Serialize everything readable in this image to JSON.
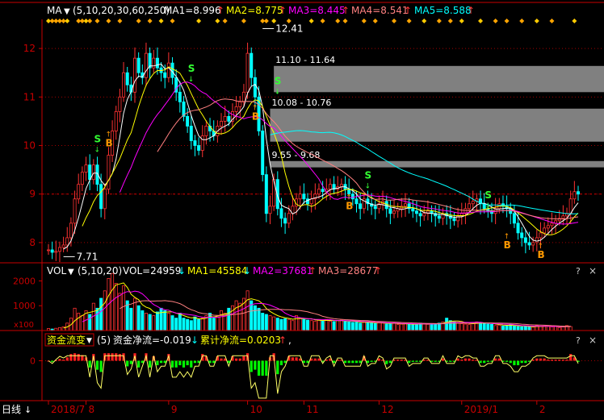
{
  "main_header": {
    "indicator": "MA",
    "params": "(5,10,20,30,60,250)",
    "items": [
      {
        "label": "MA1=8.996",
        "arrow": "↑",
        "color": "#ffffff"
      },
      {
        "label": "MA2=8.775",
        "arrow": "↑",
        "color": "#ffff00"
      },
      {
        "label": "MA3=8.445",
        "arrow": "↑",
        "color": "#ff00ff"
      },
      {
        "label": "MA4=8.541",
        "arrow": "↑",
        "color": "#ff8080"
      },
      {
        "label": "MA5=8.588",
        "arrow": "↑",
        "color": "#00ffff"
      }
    ]
  },
  "vol_header": {
    "indicator": "VOL",
    "params": "(5,10,20)",
    "value": "VOL=24959",
    "items": [
      {
        "label": "MA1=45584",
        "arrow": "↓",
        "color": "#ffff00"
      },
      {
        "label": "MA2=37681",
        "arrow": "↑",
        "color": "#ff00ff"
      },
      {
        "label": "MA3=28677",
        "arrow": "↑",
        "color": "#ff8080"
      }
    ]
  },
  "flow_header": {
    "indicator": "资金流变",
    "params": "(5)",
    "net": "资金净流=-0.019",
    "net_arrow": "↓",
    "cum": "累计净流=0.0203",
    "cum_arrow": "↑",
    "tail": ","
  },
  "toolbar": {
    "question": "?",
    "close": "×",
    "period": "日线"
  },
  "vol_unit": "x100",
  "bottom_arrow": "↓",
  "colors": {
    "up": "#ff3232",
    "down": "#00ffff",
    "zone": "#808080",
    "grid": "#a00000",
    "buy": "#ff9900",
    "sell": "#33ff33"
  },
  "chart_data": {
    "type": "candlestick",
    "ylim": [
      7.65,
      12.6
    ],
    "y_ticks": [
      8,
      9,
      10,
      11,
      12
    ],
    "x_labels": [
      {
        "label": "2018/7",
        "index": 0
      },
      {
        "label": "8",
        "index": 10
      },
      {
        "label": "9",
        "index": 32
      },
      {
        "label": "10",
        "index": 53
      },
      {
        "label": "11",
        "index": 68
      },
      {
        "label": "12",
        "index": 88
      },
      {
        "label": "2019/1",
        "index": 110
      },
      {
        "label": "2",
        "index": 130
      }
    ],
    "closes": [
      7.85,
      7.8,
      7.82,
      7.9,
      7.95,
      8.1,
      8.4,
      8.9,
      9.2,
      9.45,
      9.6,
      9.3,
      9.6,
      9.2,
      8.7,
      9.1,
      9.8,
      10.3,
      10.7,
      11.0,
      11.5,
      11.25,
      11.1,
      11.8,
      11.5,
      11.4,
      11.9,
      11.6,
      11.8,
      11.6,
      11.5,
      11.4,
      11.7,
      11.4,
      11.1,
      10.9,
      10.6,
      10.4,
      10.1,
      10.0,
      9.9,
      10.2,
      10.4,
      10.3,
      10.2,
      10.4,
      10.5,
      10.6,
      10.5,
      10.7,
      10.8,
      10.9,
      11.1,
      11.9,
      11.4,
      11.0,
      10.3,
      9.4,
      8.6,
      8.75,
      9.3,
      8.7,
      8.5,
      8.4,
      8.6,
      8.75,
      8.9,
      9.0,
      8.9,
      8.8,
      8.9,
      9.0,
      9.1,
      9.05,
      9.1,
      9.2,
      9.1,
      9.15,
      9.2,
      9.1,
      9.0,
      8.9,
      8.8,
      8.7,
      8.9,
      8.8,
      8.75,
      8.7,
      8.8,
      8.85,
      8.7,
      8.6,
      8.65,
      8.7,
      8.75,
      8.8,
      8.7,
      8.65,
      8.6,
      8.55,
      8.6,
      8.65,
      8.6,
      8.55,
      8.5,
      8.6,
      8.55,
      8.5,
      8.45,
      8.55,
      8.6,
      8.7,
      8.8,
      8.85,
      8.9,
      8.8,
      8.7,
      8.65,
      8.6,
      8.7,
      8.8,
      8.75,
      8.7,
      8.6,
      8.4,
      8.2,
      8.1,
      8.0,
      7.95,
      8.0,
      8.1,
      8.2,
      8.3,
      8.35,
      8.4,
      8.45,
      8.5,
      8.55,
      8.6,
      8.9,
      9.05,
      9.0
    ],
    "zones": [
      {
        "label": "11.10 - 11.64",
        "low": 11.1,
        "high": 11.64,
        "from_index": 60
      },
      {
        "label": "10.08 - 10.76",
        "low": 10.08,
        "high": 10.76,
        "from_index": 59
      },
      {
        "label": "9.55 - 9.68",
        "low": 9.55,
        "high": 9.68,
        "from_index": 59
      }
    ],
    "annotations": [
      {
        "text": "12.41",
        "index": 57,
        "value": 12.41
      },
      {
        "text": "7.71",
        "index": 4,
        "value": 7.71
      }
    ],
    "signals": [
      {
        "type": "B",
        "index": 16,
        "value": 10.25
      },
      {
        "type": "S",
        "index": 13,
        "value": 10.0
      },
      {
        "type": "S",
        "index": 38,
        "value": 11.45
      },
      {
        "type": "B",
        "index": 55,
        "value": 10.8
      },
      {
        "type": "S",
        "index": 61,
        "value": 11.2
      },
      {
        "type": "B",
        "index": 80,
        "value": 8.95
      },
      {
        "type": "S",
        "index": 85,
        "value": 9.25
      },
      {
        "type": "B",
        "index": 122,
        "value": 8.15
      },
      {
        "type": "S",
        "index": 117,
        "value": 8.85
      },
      {
        "type": "B",
        "index": 131,
        "value": 7.95
      }
    ],
    "vol_ylim": [
      0,
      2600
    ],
    "vol_ticks": [
      1000,
      2000
    ],
    "volumes": [
      80,
      60,
      90,
      120,
      150,
      300,
      500,
      900,
      700,
      600,
      800,
      650,
      1100,
      900,
      1300,
      1600,
      2100,
      2300,
      1900,
      1500,
      1800,
      1200,
      900,
      1300,
      1000,
      800,
      700,
      650,
      600,
      750,
      900,
      800,
      700,
      600,
      500,
      700,
      500,
      450,
      400,
      550,
      450,
      500,
      600,
      700,
      500,
      600,
      800,
      700,
      900,
      1000,
      1200,
      1100,
      1300,
      1600,
      1200,
      1000,
      900,
      700,
      650,
      600,
      550,
      500,
      450,
      480,
      450,
      400,
      600,
      500,
      450,
      420,
      400,
      380,
      420,
      400,
      450,
      380,
      360,
      400,
      420,
      380,
      350,
      330,
      340,
      300,
      360,
      320,
      300,
      280,
      330,
      300,
      260,
      280,
      300,
      240,
      260,
      280,
      250,
      230,
      260,
      300,
      280,
      250,
      260,
      280,
      300,
      350,
      500,
      400,
      350,
      300,
      280,
      260,
      240,
      300,
      350,
      330,
      280,
      260,
      250,
      200,
      220,
      180,
      200,
      250,
      180,
      160,
      150,
      170,
      150,
      140,
      200,
      160,
      180,
      170,
      150,
      160,
      120,
      150,
      200,
      160
    ],
    "flow_ylim": [
      -1.6,
      0.5
    ],
    "flow_ticks": [
      0
    ]
  }
}
